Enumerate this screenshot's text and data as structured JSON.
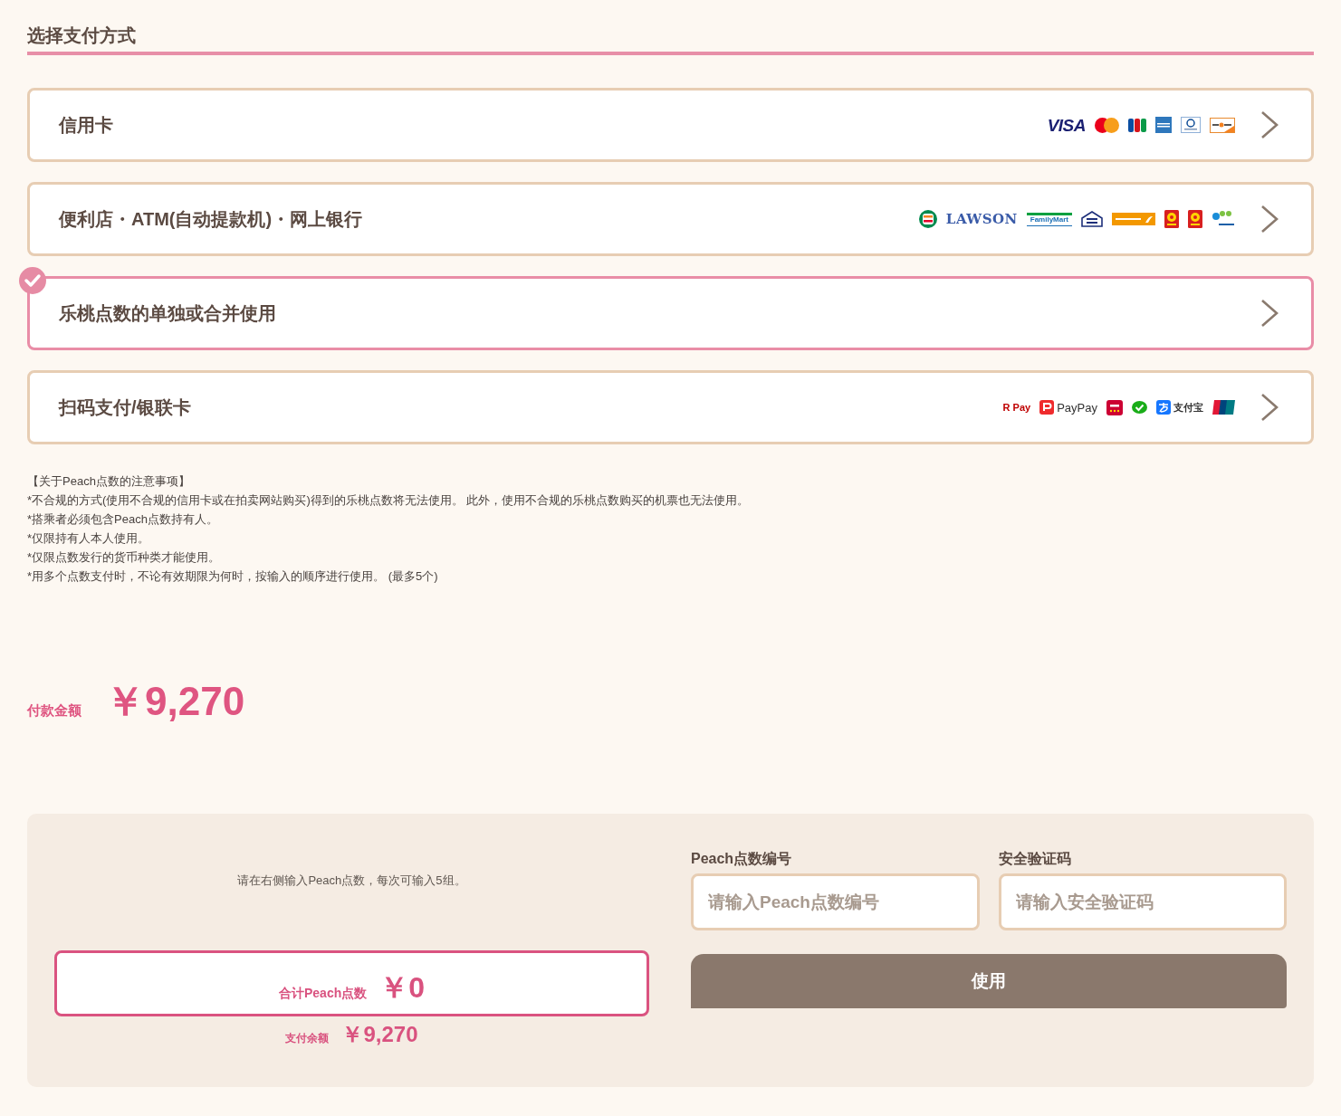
{
  "section_title": "选择支付方式",
  "methods": [
    {
      "label": "信用卡",
      "selected": false,
      "logos": [
        {
          "kind": "visa",
          "text": "VISA"
        },
        {
          "kind": "mastercard"
        },
        {
          "kind": "jcb"
        },
        {
          "kind": "amex"
        },
        {
          "kind": "diners"
        },
        {
          "kind": "discover"
        }
      ]
    },
    {
      "label": "便利店・ATM(自动提款机)・网上银行",
      "selected": false,
      "logos": [
        {
          "kind": "seven"
        },
        {
          "kind": "lawson",
          "text": "LAWSON"
        },
        {
          "kind": "familymart",
          "text": "FamilyMart"
        },
        {
          "kind": "ministop"
        },
        {
          "kind": "seicomart"
        },
        {
          "kind": "yamazaki"
        },
        {
          "kind": "yamazaki"
        },
        {
          "kind": "payeasy"
        }
      ]
    },
    {
      "label": "乐桃点数的单独或合并使用",
      "selected": true
    },
    {
      "label": "扫码支付/银联卡",
      "selected": false,
      "logos": [
        {
          "kind": "rpay",
          "text": "R Pay"
        },
        {
          "kind": "paypay",
          "text": "PayPay"
        },
        {
          "kind": "dpay"
        },
        {
          "kind": "wechat"
        },
        {
          "kind": "alipay",
          "text": "支付宝"
        },
        {
          "kind": "unionpay"
        }
      ]
    }
  ],
  "notes": [
    "【关于Peach点数的注意事项】",
    "*不合规的方式(使用不合规的信用卡或在拍卖网站购买)得到的乐桃点数将无法使用。 此外，使用不合规的乐桃点数购买的机票也无法使用。",
    "*搭乘者必须包含Peach点数持有人。",
    "*仅限持有人本人使用。",
    "*仅限点数发行的货币种类才能使用。",
    "*用多个点数支付时，不论有效期限为何时，按输入的顺序进行使用。 (最多5个)"
  ],
  "payment": {
    "label": "付款金额",
    "amount": "￥9,270"
  },
  "points_panel": {
    "instruction": "请在右侧输入Peach点数，每次可输入5组。",
    "total": {
      "label": "合计Peach点数",
      "value": "￥0"
    },
    "balance": {
      "label": "支付余额",
      "value": "￥9,270"
    },
    "fields": [
      {
        "label": "Peach点数编号",
        "placeholder": "请输入Peach点数编号"
      },
      {
        "label": "安全验证码",
        "placeholder": "请输入安全验证码"
      }
    ],
    "button": "使用"
  }
}
